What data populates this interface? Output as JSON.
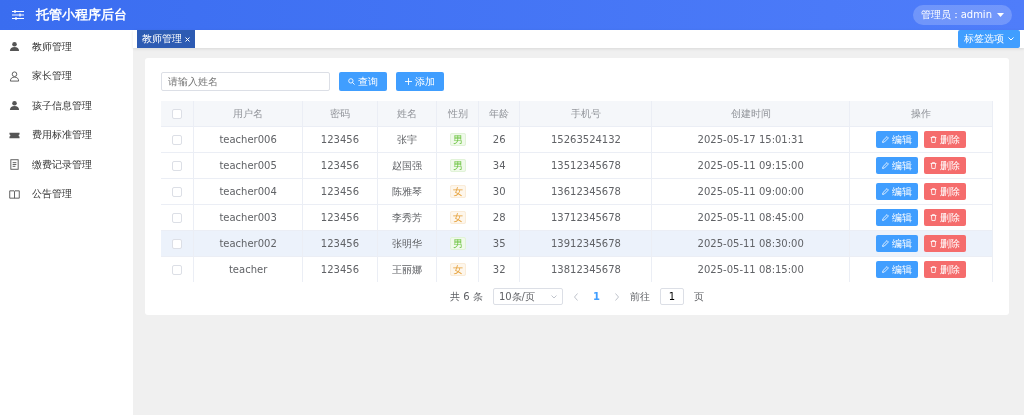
{
  "header": {
    "title": "托管小程序后台",
    "user": "管理员：admin"
  },
  "sidebar": {
    "items": [
      {
        "label": "教师管理"
      },
      {
        "label": "家长管理"
      },
      {
        "label": "孩子信息管理"
      },
      {
        "label": "费用标准管理"
      },
      {
        "label": "缴费记录管理"
      },
      {
        "label": "公告管理"
      }
    ]
  },
  "tags": [
    {
      "label": "教师管理",
      "selected": true
    }
  ],
  "tag_options": "标签选项",
  "search": {
    "placeholder": "请输入姓名"
  },
  "buttons": {
    "query": "查询",
    "add": "添加"
  },
  "table": {
    "select_all_checked": false,
    "columns": [
      "用户名",
      "密码",
      "姓名",
      "性别",
      "年龄",
      "手机号",
      "创建时间",
      "操作"
    ],
    "rows": [
      {
        "username": "teacher006",
        "password": "123456",
        "name": "张宇",
        "gender": {
          "label": "男",
          "kind": "male"
        },
        "age": "26",
        "phone": "15263524132",
        "created": "2025-05-17 15:01:31",
        "edit": "编辑",
        "delete": "删除",
        "hovered": false,
        "checked": false
      },
      {
        "username": "teacher005",
        "password": "123456",
        "name": "赵国强",
        "gender": {
          "label": "男",
          "kind": "male"
        },
        "age": "34",
        "phone": "13512345678",
        "created": "2025-05-11 09:15:00",
        "edit": "编辑",
        "delete": "删除",
        "hovered": false,
        "checked": false
      },
      {
        "username": "teacher004",
        "password": "123456",
        "name": "陈雅琴",
        "gender": {
          "label": "女",
          "kind": "female"
        },
        "age": "30",
        "phone": "13612345678",
        "created": "2025-05-11 09:00:00",
        "edit": "编辑",
        "delete": "删除",
        "hovered": false,
        "checked": false
      },
      {
        "username": "teacher003",
        "password": "123456",
        "name": "李秀芳",
        "gender": {
          "label": "女",
          "kind": "female"
        },
        "age": "28",
        "phone": "13712345678",
        "created": "2025-05-11 08:45:00",
        "edit": "编辑",
        "delete": "删除",
        "hovered": false,
        "checked": false
      },
      {
        "username": "teacher002",
        "password": "123456",
        "name": "张明华",
        "gender": {
          "label": "男",
          "kind": "male"
        },
        "age": "35",
        "phone": "13912345678",
        "created": "2025-05-11 08:30:00",
        "edit": "编辑",
        "delete": "删除",
        "hovered": true,
        "checked": false
      },
      {
        "username": "teacher",
        "password": "123456",
        "name": "王丽娜",
        "gender": {
          "label": "女",
          "kind": "female"
        },
        "age": "32",
        "phone": "13812345678",
        "created": "2025-05-11 08:15:00",
        "edit": "编辑",
        "delete": "删除",
        "hovered": false,
        "checked": false
      }
    ]
  },
  "pagination": {
    "total": "共 6 条",
    "page_size": "10条/页",
    "pages": [
      {
        "label": "1",
        "selected": true
      }
    ],
    "goto_label": "前往",
    "goto_value": "1",
    "goto_suffix": "页"
  }
}
